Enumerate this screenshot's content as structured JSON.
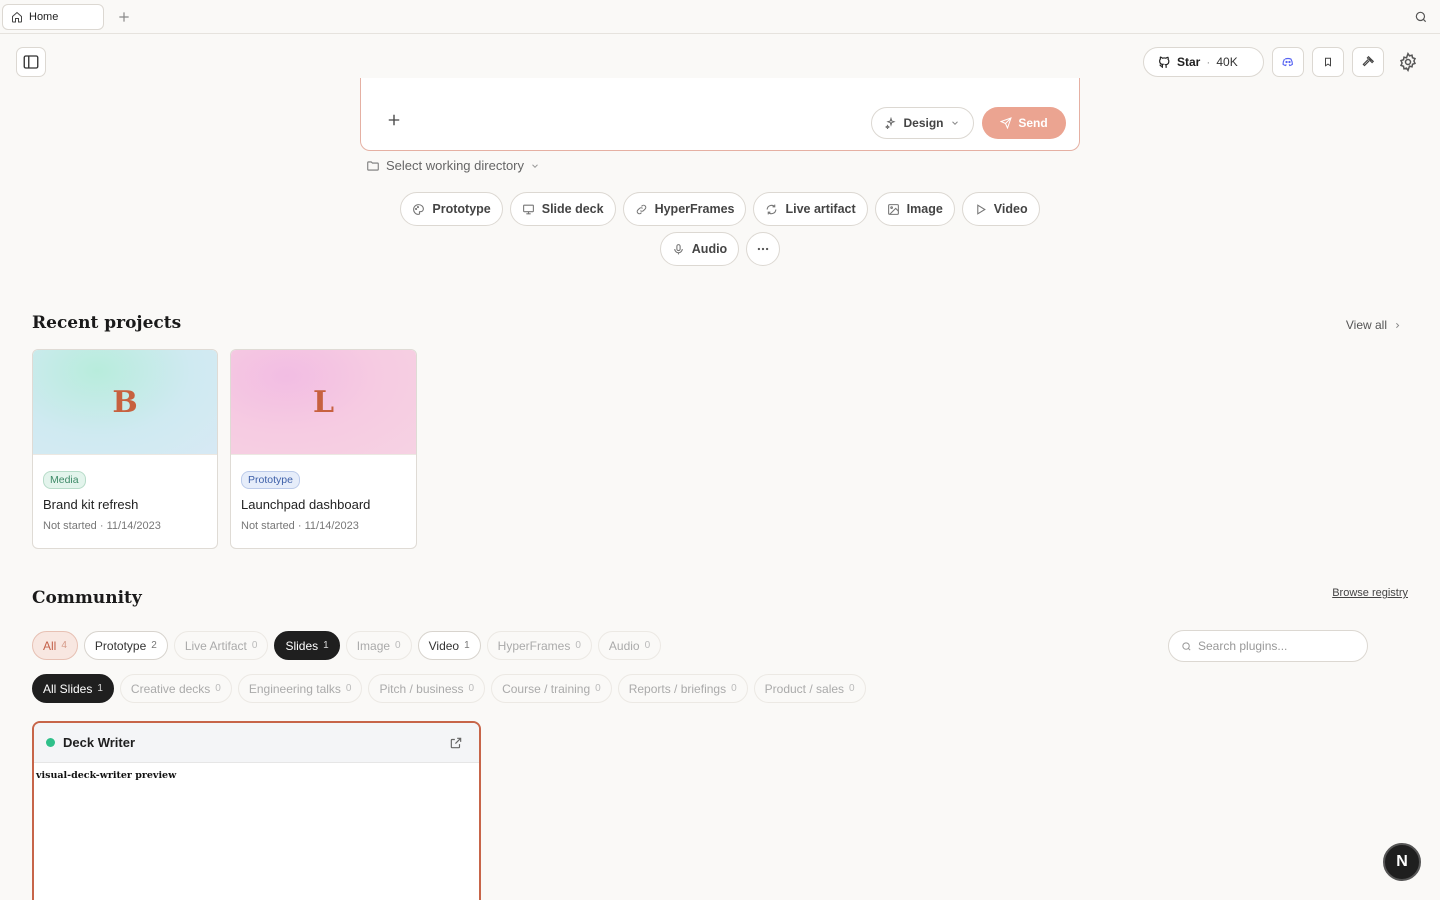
{
  "tabbar": {
    "active_tab": "Home"
  },
  "header": {
    "star_label": "Star",
    "star_separator": "·",
    "star_count": "40K"
  },
  "composer": {
    "design_label": "Design",
    "send_label": "Send",
    "workdir_label": "Select working directory"
  },
  "modes": [
    {
      "label": "Prototype",
      "icon": "palette-icon"
    },
    {
      "label": "Slide deck",
      "icon": "monitor-icon"
    },
    {
      "label": "HyperFrames",
      "icon": "link-icon"
    },
    {
      "label": "Live artifact",
      "icon": "refresh-icon"
    },
    {
      "label": "Image",
      "icon": "image-icon"
    },
    {
      "label": "Video",
      "icon": "play-icon"
    },
    {
      "label": "Audio",
      "icon": "mic-icon"
    }
  ],
  "recent": {
    "title": "Recent projects",
    "view_all": "View all",
    "projects": [
      {
        "initial": "B",
        "tag": "Media",
        "name": "Brand kit refresh",
        "status": "Not started",
        "sep": "·",
        "date": "11/14/2023"
      },
      {
        "initial": "L",
        "tag": "Prototype",
        "name": "Launchpad dashboard",
        "status": "Not started",
        "sep": "·",
        "date": "11/14/2023"
      }
    ]
  },
  "community": {
    "title": "Community",
    "browse": "Browse registry",
    "search_placeholder": "Search plugins...",
    "categories": [
      {
        "label": "All",
        "count": "4"
      },
      {
        "label": "Prototype",
        "count": "2"
      },
      {
        "label": "Live Artifact",
        "count": "0"
      },
      {
        "label": "Slides",
        "count": "1"
      },
      {
        "label": "Image",
        "count": "0"
      },
      {
        "label": "Video",
        "count": "1"
      },
      {
        "label": "HyperFrames",
        "count": "0"
      },
      {
        "label": "Audio",
        "count": "0"
      }
    ],
    "subcategories": [
      {
        "label": "All Slides",
        "count": "1"
      },
      {
        "label": "Creative decks",
        "count": "0"
      },
      {
        "label": "Engineering talks",
        "count": "0"
      },
      {
        "label": "Pitch / business",
        "count": "0"
      },
      {
        "label": "Course / training",
        "count": "0"
      },
      {
        "label": "Reports / briefings",
        "count": "0"
      },
      {
        "label": "Product / sales",
        "count": "0"
      }
    ],
    "plugin": {
      "name": "Deck Writer",
      "preview": "visual-deck-writer preview"
    }
  },
  "fab": {
    "label": "N"
  }
}
